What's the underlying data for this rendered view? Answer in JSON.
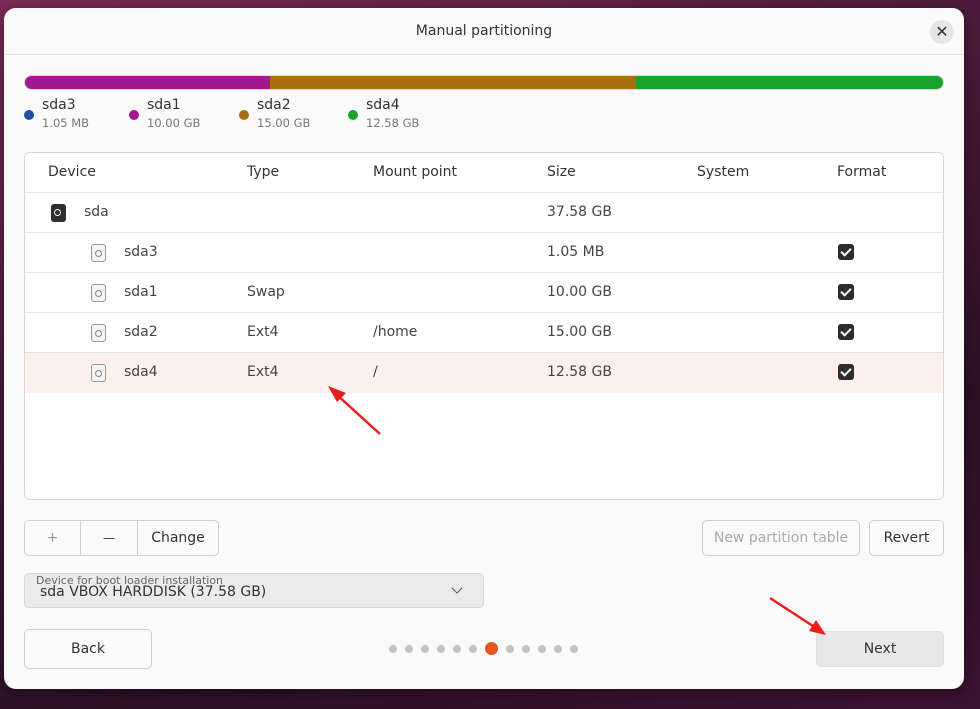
{
  "dialog": {
    "title": "Manual partitioning",
    "close_label": "✕"
  },
  "usage_bar": {
    "segments": [
      {
        "name": "sda3",
        "color": "#1c4fa0",
        "fraction": 0.0003
      },
      {
        "name": "sda1",
        "color": "#a3198f",
        "fraction": 0.2661
      },
      {
        "name": "sda2",
        "color": "#a86f10",
        "fraction": 0.3991
      },
      {
        "name": "sda4",
        "color": "#1aa22e",
        "fraction": 0.3345
      }
    ]
  },
  "legend": [
    {
      "name": "sda3",
      "size": "1.05 MB",
      "color": "#1c4fa0"
    },
    {
      "name": "sda1",
      "size": "10.00 GB",
      "color": "#a3198f"
    },
    {
      "name": "sda2",
      "size": "15.00 GB",
      "color": "#a86f10"
    },
    {
      "name": "sda4",
      "size": "12.58 GB",
      "color": "#1aa22e"
    }
  ],
  "table": {
    "headers": {
      "device": "Device",
      "type": "Type",
      "mount": "Mount point",
      "size": "Size",
      "system": "System",
      "format": "Format"
    },
    "rows": [
      {
        "device": "sda",
        "type": "",
        "mount": "",
        "size": "37.58 GB",
        "system": "",
        "format": false,
        "disk": true
      },
      {
        "device": "sda3",
        "type": "",
        "mount": "",
        "size": "1.05 MB",
        "system": "",
        "format": true
      },
      {
        "device": "sda1",
        "type": "Swap",
        "mount": "",
        "size": "10.00 GB",
        "system": "",
        "format": true
      },
      {
        "device": "sda2",
        "type": "Ext4",
        "mount": "/home",
        "size": "15.00 GB",
        "system": "",
        "format": true
      },
      {
        "device": "sda4",
        "type": "Ext4",
        "mount": "/",
        "size": "12.58 GB",
        "system": "",
        "format": true,
        "selected": true
      }
    ]
  },
  "toolbar": {
    "add_label": "+",
    "remove_label": "—",
    "change_label": "Change",
    "new_table_label": "New partition table",
    "revert_label": "Revert"
  },
  "bootloader": {
    "label": "Device for boot loader installation",
    "value": "sda VBOX HARDDISK (37.58 GB)"
  },
  "nav": {
    "back_label": "Back",
    "next_label": "Next",
    "page_count": 12,
    "current_page": 7
  }
}
